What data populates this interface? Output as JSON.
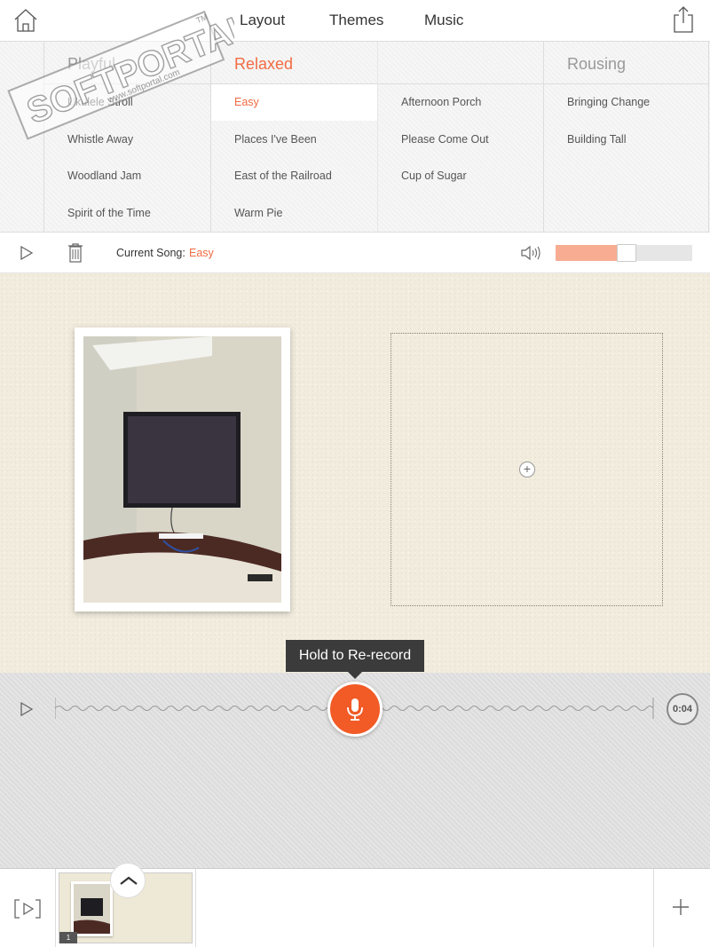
{
  "header": {
    "tabs": [
      {
        "label": "Layout"
      },
      {
        "label": "Themes"
      },
      {
        "label": "Music"
      }
    ],
    "icons": {
      "home": "home-icon",
      "share": "share-icon"
    }
  },
  "watermark": {
    "text": "SOFTPORTAL",
    "url": "www.softportal.com",
    "tm": "TM"
  },
  "music": {
    "accent": "#f26b43",
    "columns": [
      {
        "title": "Playful",
        "songs": [
          "Ukulele Stroll",
          "Whistle Away",
          "Woodland Jam",
          "Spirit of the Time"
        ]
      },
      {
        "title": "Relaxed",
        "songs": [
          "Easy",
          "Places I've Been",
          "East of the Railroad",
          "Warm Pie"
        ]
      },
      {
        "title": "",
        "songs": [
          "Afternoon Porch",
          "Please Come Out",
          "Cup of Sugar"
        ]
      },
      {
        "title": "Rousing",
        "songs": [
          "Bringing Change",
          "Building Tall"
        ]
      }
    ],
    "selected": "Easy"
  },
  "song_bar": {
    "current_label": "Current Song:",
    "current_value": "Easy",
    "volume_level": 0.52,
    "icons": {
      "play": "play-icon",
      "trash": "trash-icon",
      "volume": "volume-icon"
    }
  },
  "canvas": {
    "add_icon": "plus-circle-icon"
  },
  "recorder": {
    "tooltip": "Hold to Re-record",
    "duration": "0:04",
    "mic_color": "#f25a26",
    "icons": {
      "play": "play-icon",
      "mic": "microphone-icon"
    }
  },
  "footer": {
    "slide_number": "1",
    "icons": {
      "preview": "preview-icon",
      "collapse": "chevron-up-icon",
      "add": "plus-icon"
    }
  }
}
